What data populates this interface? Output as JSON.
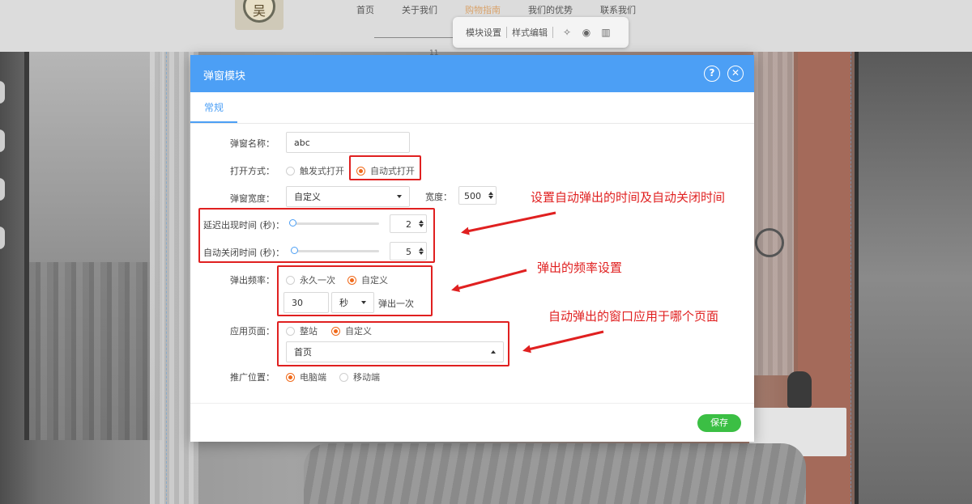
{
  "site": {
    "logo_char": "吴",
    "nav": [
      "首页",
      "关于我们",
      "购物指南",
      "我们的优势",
      "联系我们"
    ],
    "nav_active": 2,
    "nav_number": "11"
  },
  "editor_toolbar": {
    "module_settings": "模块设置",
    "style_edit": "样式编辑",
    "icons": [
      "wand-icon",
      "eye-icon",
      "trash-icon"
    ]
  },
  "dialog": {
    "title": "弹窗模块",
    "tab": "常规",
    "name_label": "弹窗名称：",
    "name_value": "abc",
    "open_label": "打开方式：",
    "open_options": [
      "触发式打开",
      "自动式打开"
    ],
    "open_selected": 1,
    "width_label": "弹窗宽度：",
    "width_select": "自定义",
    "width_field_label": "宽度：",
    "width_value": "500",
    "delay_label": "延迟出现时间 (秒)：",
    "delay_value": "2",
    "close_label": "自动关闭时间 (秒)：",
    "close_value": "5",
    "freq_label": "弹出频率：",
    "freq_options": [
      "永久一次",
      "自定义"
    ],
    "freq_selected": 1,
    "freq_number": "30",
    "freq_unit": "秒",
    "freq_suffix": "弹出一次",
    "page_label": "应用页面：",
    "page_options": [
      "整站",
      "自定义"
    ],
    "page_selected": 1,
    "page_select": "首页",
    "promo_label": "推广位置：",
    "promo_options": [
      "电脑端",
      "移动端"
    ],
    "promo_selected": 0,
    "save_label": "保存"
  },
  "annotations": [
    "设置自动弹出的时间及自动关闭时间",
    "弹出的频率设置",
    "自动弹出的窗口应用于哪个页面"
  ],
  "colors": {
    "header_blue": "#4c9ff5",
    "radio_orange": "#f06a1b",
    "save_green": "#3bbf44",
    "annotation_red": "#e02020"
  }
}
